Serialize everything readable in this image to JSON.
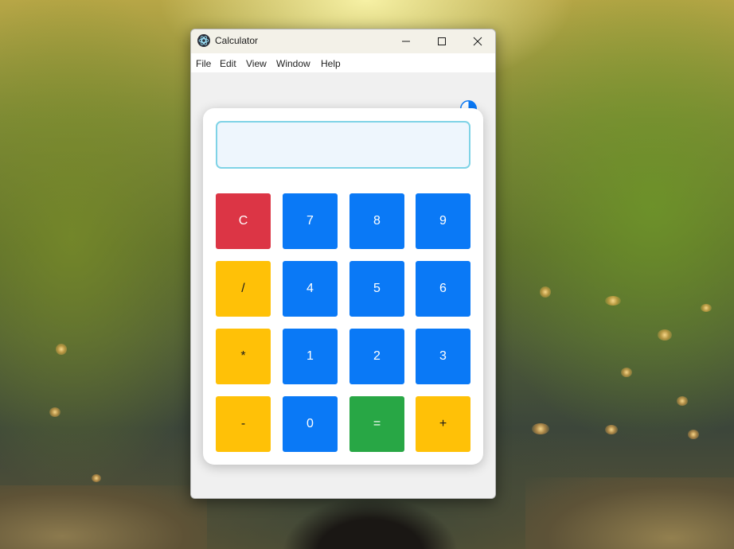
{
  "window": {
    "title": "Calculator",
    "controls": [
      "minimize",
      "maximize",
      "close"
    ]
  },
  "menu": {
    "items": [
      "File",
      "Edit",
      "View",
      "Window",
      "Help"
    ]
  },
  "calculator": {
    "display_value": "",
    "keys": [
      {
        "label": "C",
        "role": "clear",
        "color": "#dc3545"
      },
      {
        "label": "7",
        "role": "digit",
        "color": "#0a79f6"
      },
      {
        "label": "8",
        "role": "digit",
        "color": "#0a79f6"
      },
      {
        "label": "9",
        "role": "digit",
        "color": "#0a79f6"
      },
      {
        "label": "/",
        "role": "operator",
        "color": "#ffc107"
      },
      {
        "label": "4",
        "role": "digit",
        "color": "#0a79f6"
      },
      {
        "label": "5",
        "role": "digit",
        "color": "#0a79f6"
      },
      {
        "label": "6",
        "role": "digit",
        "color": "#0a79f6"
      },
      {
        "label": "*",
        "role": "operator",
        "color": "#ffc107"
      },
      {
        "label": "1",
        "role": "digit",
        "color": "#0a79f6"
      },
      {
        "label": "2",
        "role": "digit",
        "color": "#0a79f6"
      },
      {
        "label": "3",
        "role": "digit",
        "color": "#0a79f6"
      },
      {
        "label": "-",
        "role": "operator",
        "color": "#ffc107"
      },
      {
        "label": "0",
        "role": "digit",
        "color": "#0a79f6"
      },
      {
        "label": "=",
        "role": "equals",
        "color": "#28a745"
      },
      {
        "label": "+",
        "role": "operator",
        "color": "#ffc107"
      }
    ]
  },
  "theme_toggle": {
    "icon": "half-circle-icon",
    "color": "#0a79f6"
  }
}
